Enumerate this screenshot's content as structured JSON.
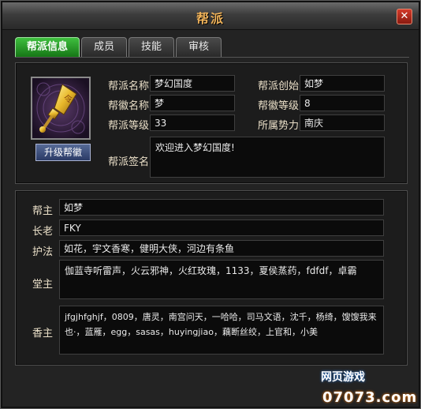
{
  "window": {
    "title": "帮派"
  },
  "tabs": [
    {
      "label": "帮派信息",
      "active": true
    },
    {
      "label": "成员",
      "active": false
    },
    {
      "label": "技能",
      "active": false
    },
    {
      "label": "审核",
      "active": false
    }
  ],
  "info": {
    "upgrade_button": "升级帮徽",
    "name_label": "帮派名称",
    "name_value": "梦幻国度",
    "founder_label": "帮派创始",
    "founder_value": "如梦",
    "emblem_name_label": "帮徽名称",
    "emblem_name_value": "梦",
    "emblem_level_label": "帮徽等级",
    "emblem_level_value": "8",
    "guild_level_label": "帮派等级",
    "guild_level_value": "33",
    "faction_label": "所属势力",
    "faction_value": "南庆",
    "signature_label": "帮派签名",
    "signature_value": "欢迎进入梦幻国度!"
  },
  "roles": {
    "leader_label": "帮主",
    "leader_value": "如梦",
    "elder_label": "长老",
    "elder_value": "FKY",
    "protector_label": "护法",
    "protector_value": "如花，宇文香寒，健明大侠，河边有条鱼",
    "hall_label": "堂主",
    "hall_value": "伽蓝寺听雷声，火云邪神，火红玫瑰，1133，夏侯蒸药，fdfdf，卓霸",
    "incense_label": "香主",
    "incense_value": "jfgjhfghjf，0809，唐灵，南宫问天，一哈哈，司马文语，沈千，杨绮，馊馊我来也·，蓝雁，egg，sasas，huyingjiao，藕断丝绞，上官和，小美"
  },
  "watermark": {
    "line1": "网页游戏",
    "line2": "07073.com"
  },
  "colors": {
    "accent_tab": "#2a9a2a",
    "title": "#f0b35a",
    "close": "#c0281c"
  }
}
